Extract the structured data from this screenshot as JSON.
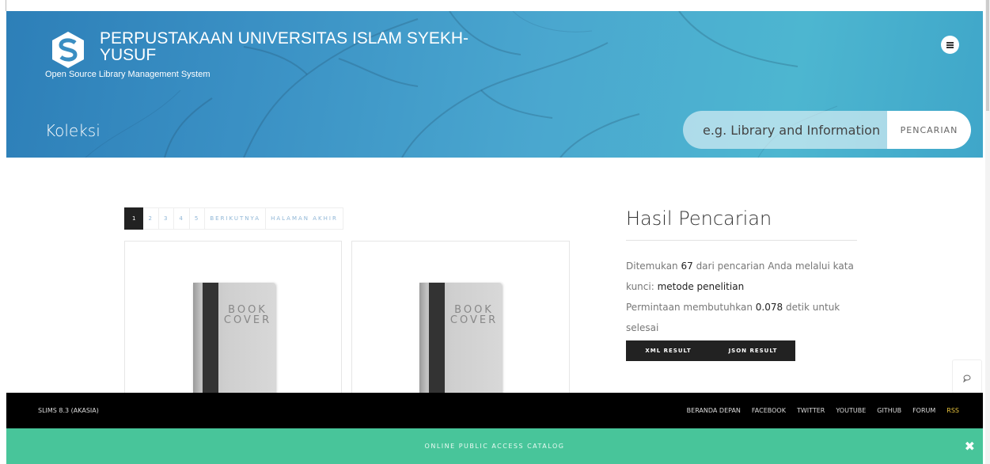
{
  "header": {
    "title": "PERPUSTAKAAN UNIVERSITAS ISLAM SYEKH-YUSUF",
    "subtitle": "Open Source Library Management System",
    "page_title": "Koleksi"
  },
  "search": {
    "placeholder": "e.g. Library and Information",
    "button_label": "PENCARIAN"
  },
  "pagination": {
    "pages": [
      "1",
      "2",
      "3",
      "4",
      "5"
    ],
    "next_label": "BERIKUTNYA",
    "last_label": "HALAMAN AKHIR",
    "active_page": "1"
  },
  "books": [
    {
      "cover_line1": "BOOK",
      "cover_line2": "COVER"
    },
    {
      "cover_line1": "BOOK",
      "cover_line2": "COVER"
    }
  ],
  "results": {
    "title": "Hasil Pencarian",
    "found_prefix": "Ditemukan ",
    "found_count": "67",
    "found_mid": " dari pencarian Anda melalui kata kunci: ",
    "keyword": "metode penelitian",
    "time_prefix": "Permintaan membutuhkan ",
    "time_value": "0.078",
    "time_suffix": " detik untuk selesai",
    "xml_label": "XML RESULT",
    "json_label": "JSON RESULT"
  },
  "footer": {
    "version": "SLIMS 8.3 (AKASIA)",
    "links": [
      "BERANDA DEPAN",
      "FACEBOOK",
      "TWITTER",
      "YOUTUBE",
      "GITHUB",
      "FORUM",
      "RSS"
    ],
    "rss_color": "#e8c33c"
  },
  "opac_bar": {
    "label": "ONLINE PUBLIC ACCESS CATALOG",
    "close_icon": "✖",
    "color": "#48c59a"
  },
  "colors": {
    "header_blue": "#3a90c4",
    "footer_black": "#000000"
  }
}
